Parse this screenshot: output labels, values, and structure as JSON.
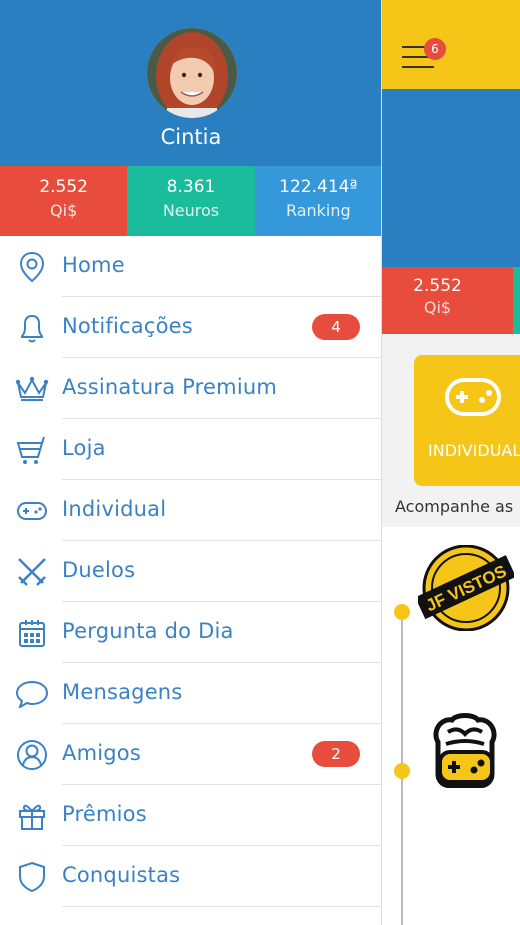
{
  "background_app": {
    "menu_badge_count": "6",
    "qi_value": "2.552",
    "qi_label": "Qi$",
    "mode_card_label": "INDIVIDUAL",
    "follow_text": "Acompanhe as",
    "jf_logo_text": "JF VISTOS"
  },
  "profile": {
    "name": "Cintia"
  },
  "stats": [
    {
      "value": "2.552",
      "label": "Qi$"
    },
    {
      "value": "8.361",
      "label": "Neuros"
    },
    {
      "value": "122.414ª",
      "label": "Ranking"
    }
  ],
  "menu": {
    "items": [
      {
        "label": "Home",
        "icon": "location-pin-icon"
      },
      {
        "label": "Notificações",
        "icon": "bell-icon",
        "badge": "4"
      },
      {
        "label": "Assinatura Premium",
        "icon": "crown-icon"
      },
      {
        "label": "Loja",
        "icon": "cart-icon"
      },
      {
        "label": "Individual",
        "icon": "gamepad-icon"
      },
      {
        "label": "Duelos",
        "icon": "crossed-swords-icon"
      },
      {
        "label": "Pergunta do Dia",
        "icon": "calendar-icon"
      },
      {
        "label": "Mensagens",
        "icon": "chat-bubble-icon"
      },
      {
        "label": "Amigos",
        "icon": "friends-icon",
        "badge": "2"
      },
      {
        "label": "Prêmios",
        "icon": "gift-icon"
      },
      {
        "label": "Conquistas",
        "icon": "shield-icon"
      }
    ]
  },
  "colors": {
    "drawer_header": "#2a7fc0",
    "stat_red": "#e74c3c",
    "stat_green": "#1abc9c",
    "stat_blue": "#3498db",
    "accent_yellow": "#f5c518",
    "menu_text": "#3b82c4",
    "badge": "#e74c3c"
  }
}
